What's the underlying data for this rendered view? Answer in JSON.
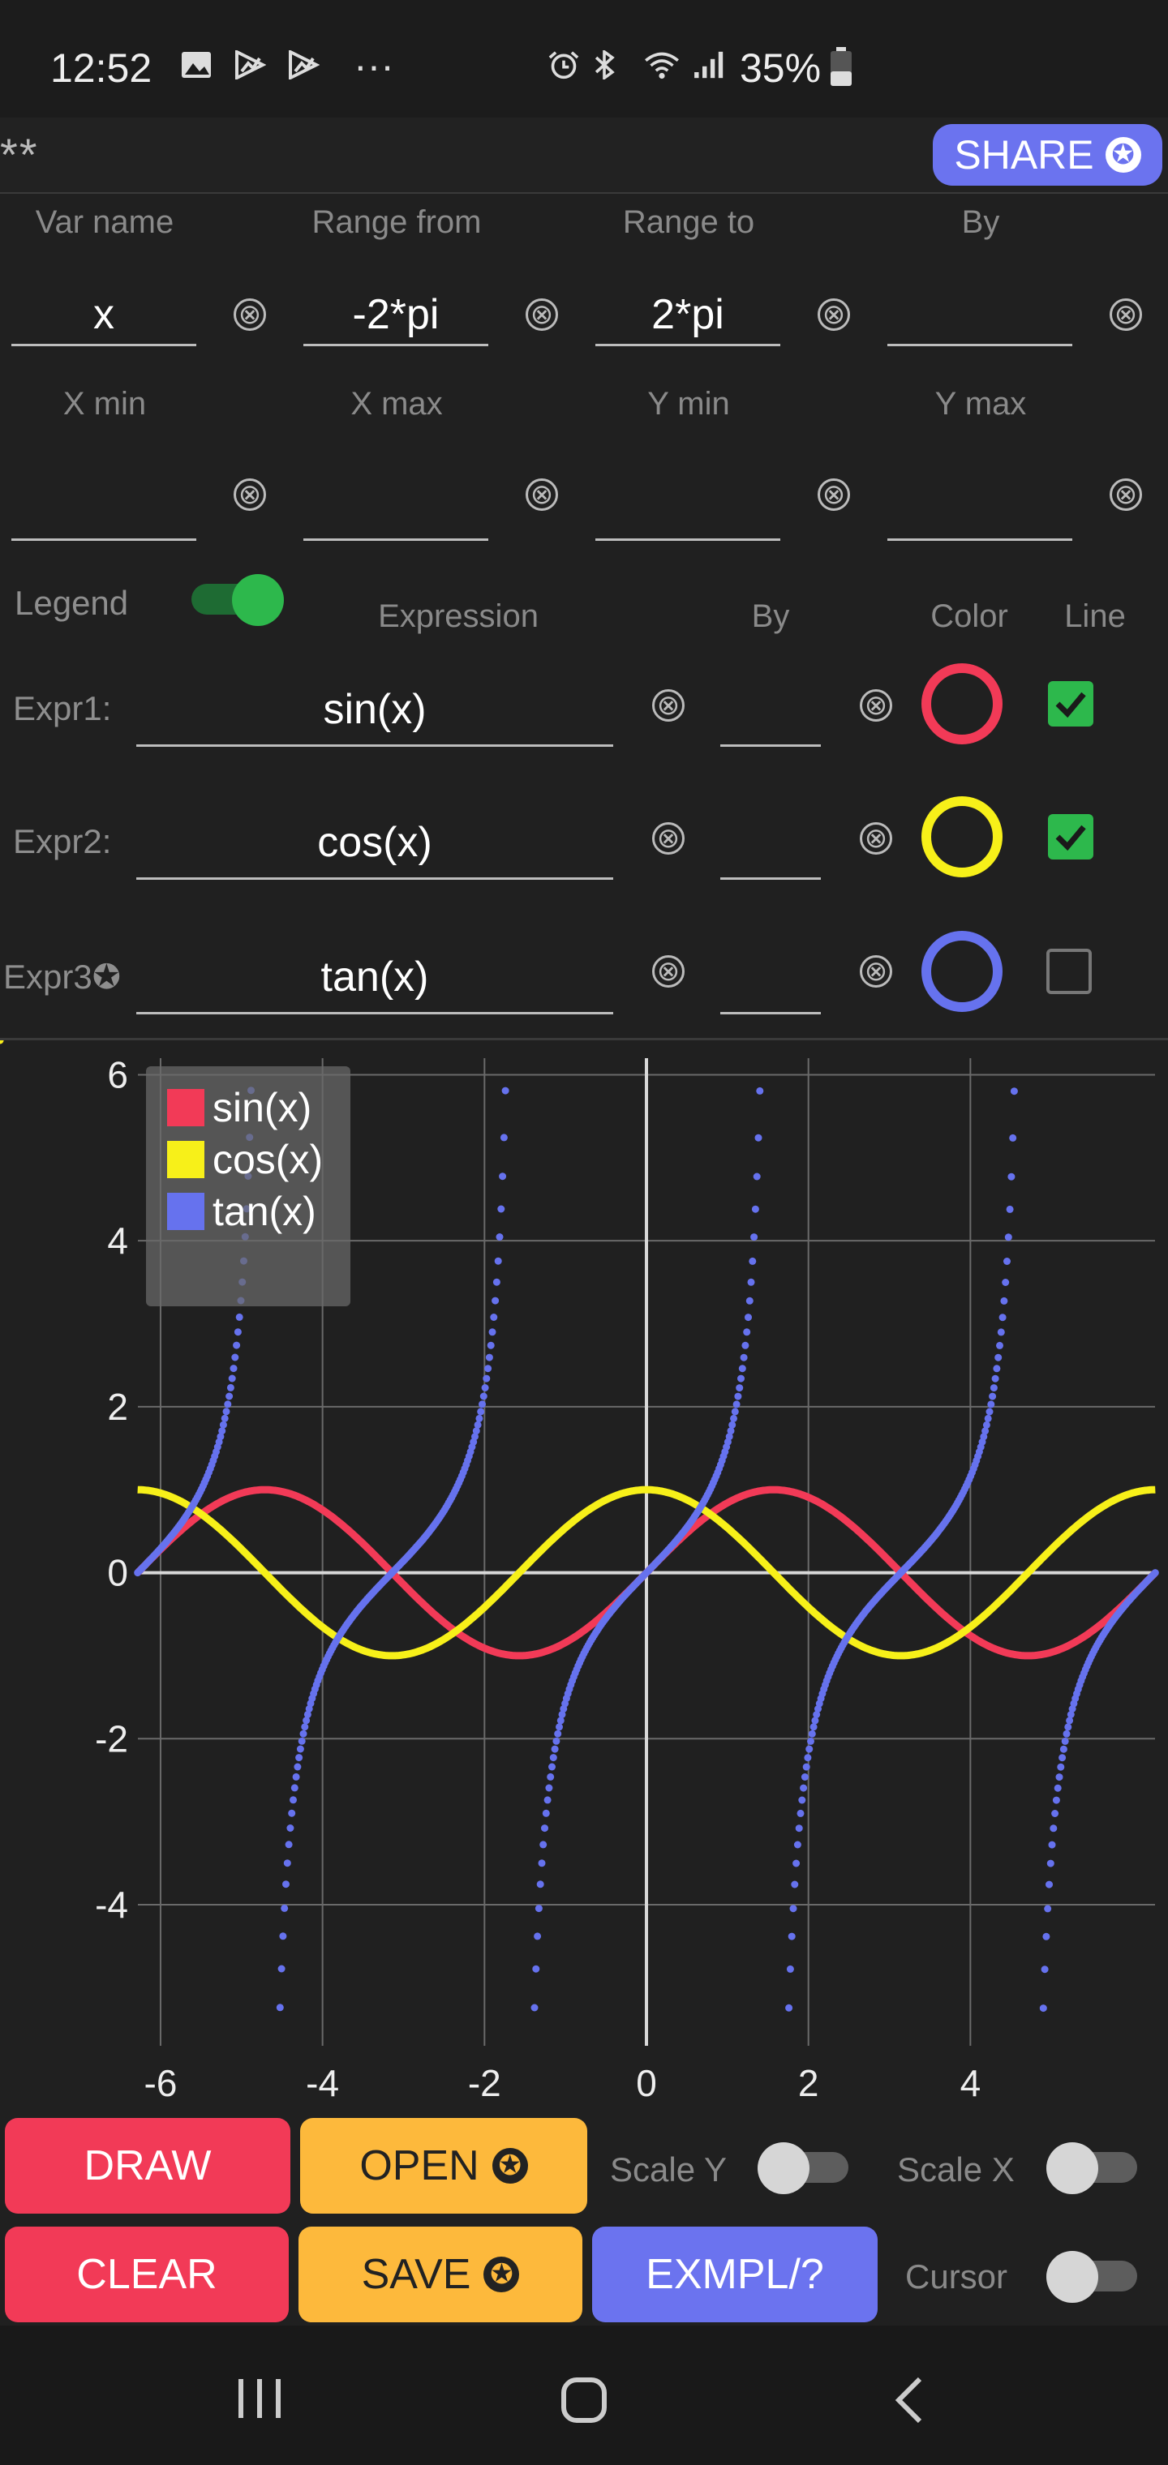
{
  "status_bar": {
    "time": "12:52",
    "left_icons": [
      "gallery-icon",
      "play-store-icon",
      "play-store-icon",
      "more-dots-icon"
    ],
    "more": "···",
    "right_icons": [
      "alarm-icon",
      "bluetooth-icon",
      "wifi-icon",
      "signal-icon",
      "battery-icon"
    ],
    "battery": "35%"
  },
  "topbar": {
    "stars": "**",
    "share_label": "SHARE",
    "share_star": "✪"
  },
  "range": {
    "labels": [
      "Var name",
      "Range from",
      "Range to",
      "By"
    ],
    "values": [
      "x",
      "-2*pi",
      "2*pi",
      ""
    ]
  },
  "limits": {
    "labels": [
      "X min",
      "X max",
      "Y min",
      "Y max"
    ],
    "values": [
      "",
      "",
      "",
      ""
    ]
  },
  "clear_glyph": "⊗",
  "legend_label": "Legend",
  "legend_on": true,
  "expr_headers": {
    "expression": "Expression",
    "by": "By",
    "color": "Color",
    "line": "Line"
  },
  "expressions": [
    {
      "label": "Expr1:",
      "expr": "sin(x)",
      "by": "",
      "color": "#f23a57",
      "line": true
    },
    {
      "label": "Expr2:",
      "expr": "cos(x)",
      "by": "",
      "color": "#f7f019",
      "line": true
    },
    {
      "label": "Expr3✪",
      "expr": "tan(x)",
      "by": "",
      "color": "#6672ee",
      "line": false
    }
  ],
  "chart_data": {
    "type": "line",
    "x_range": [
      -6.283,
      6.283
    ],
    "xlim": [
      -6.28,
      6.28
    ],
    "ylim": [
      -5.7,
      6.2
    ],
    "x_ticks": [
      -6,
      -4,
      -2,
      0,
      2,
      4
    ],
    "y_ticks": [
      6,
      4,
      2,
      0,
      -2,
      -4
    ],
    "grid": true,
    "legend_position": "top-left",
    "series": [
      {
        "name": "sin(x)",
        "function": "sin",
        "color": "#f23a57",
        "line": true
      },
      {
        "name": "cos(x)",
        "function": "cos",
        "color": "#f7f019",
        "line": true
      },
      {
        "name": "tan(x)",
        "function": "tan",
        "color": "#6672ee",
        "line": false
      }
    ]
  },
  "buttons": {
    "draw": "DRAW",
    "clear": "CLEAR",
    "open": "OPEN",
    "save": "SAVE",
    "exmpl": "EXMPL/?",
    "star": "✪"
  },
  "toggles": {
    "scale_y": {
      "label": "Scale Y",
      "on": false
    },
    "scale_x": {
      "label": "Scale X",
      "on": false
    },
    "cursor": {
      "label": "Cursor",
      "on": false
    }
  },
  "navbar": {
    "icons": [
      "recent-apps-icon",
      "home-icon",
      "back-icon"
    ]
  }
}
